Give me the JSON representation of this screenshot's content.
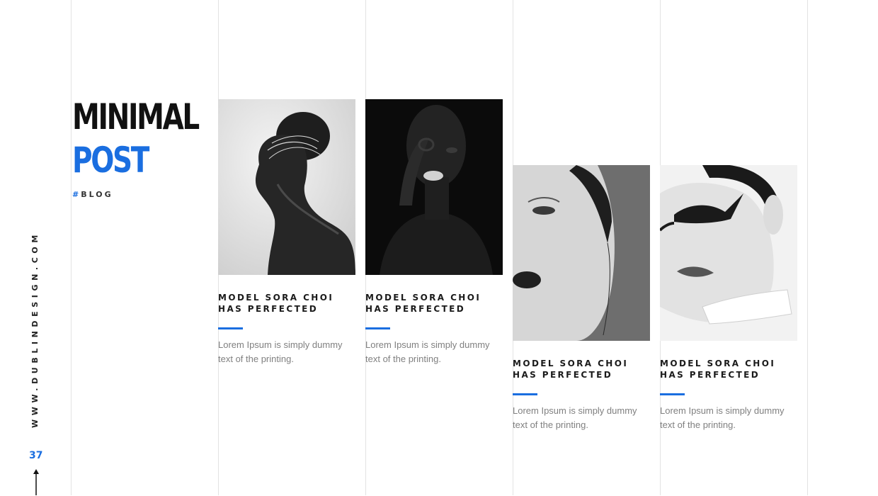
{
  "colors": {
    "accent": "#1a6ee0",
    "text_dark": "#111111",
    "text_muted": "#808080",
    "divider": "#e3e3e3"
  },
  "header": {
    "title_line1": "MINIMAL",
    "title_line2": "POST",
    "tag_hash": "#",
    "tag_text": "BLOG"
  },
  "sidebar": {
    "url": "WWW.DUBLINDESIGN.COM",
    "page_number": "37",
    "arrow_icon": "arrow-up-icon"
  },
  "cards": [
    {
      "image": "model-profile-photo",
      "title": "MODEL SORA CHOI HAS PERFECTED",
      "text": "Lorem Ipsum is simply dummy text of the printing."
    },
    {
      "image": "model-dark-portrait-photo",
      "title": "MODEL SORA CHOI HAS PERFECTED",
      "text": "Lorem Ipsum is simply dummy text of the printing."
    },
    {
      "image": "model-closeup-photo",
      "title": "MODEL SORA CHOI HAS PERFECTED",
      "text": "Lorem Ipsum is simply dummy text of the printing."
    },
    {
      "image": "model-eyeliner-photo",
      "title": "MODEL SORA CHOI HAS PERFECTED",
      "text": "Lorem Ipsum is simply dummy text of the printing."
    }
  ]
}
